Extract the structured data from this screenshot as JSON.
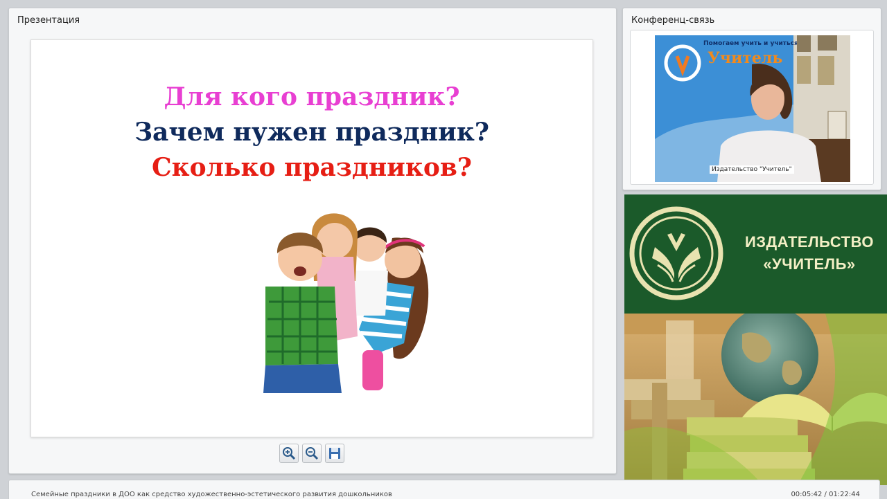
{
  "presentation": {
    "title": "Презентация",
    "slide": {
      "line1": "Для кого праздник?",
      "line2": "Зачем нужен праздник?",
      "line3": "Сколько праздников?",
      "colors": {
        "line1": "#e83fd2",
        "line2": "#0f2a5c",
        "line3": "#e61e14"
      }
    },
    "toolbar": {
      "zoom_in_icon": "zoom-in-icon",
      "zoom_out_icon": "zoom-out-icon",
      "save_icon": "floppy-disk-icon"
    }
  },
  "conference": {
    "title": "Конференц-связь",
    "video_label": "Издательство \"Учитель\"",
    "banner_lines": [
      "Помогаем учить и учиться",
      "Учитель"
    ]
  },
  "promo": {
    "brand_line1": "ИЗДАТЕЛЬСТВО",
    "brand_line2": "«УЧИТЕЛЬ»",
    "colors": {
      "green": "#1b5a2a",
      "cream": "#f4f0c6"
    }
  },
  "footer": {
    "title": "Семейные праздники в ДОО как средство художественно-эстетического развития дошкольников",
    "time": "00:05:42 / 01:22:44"
  }
}
